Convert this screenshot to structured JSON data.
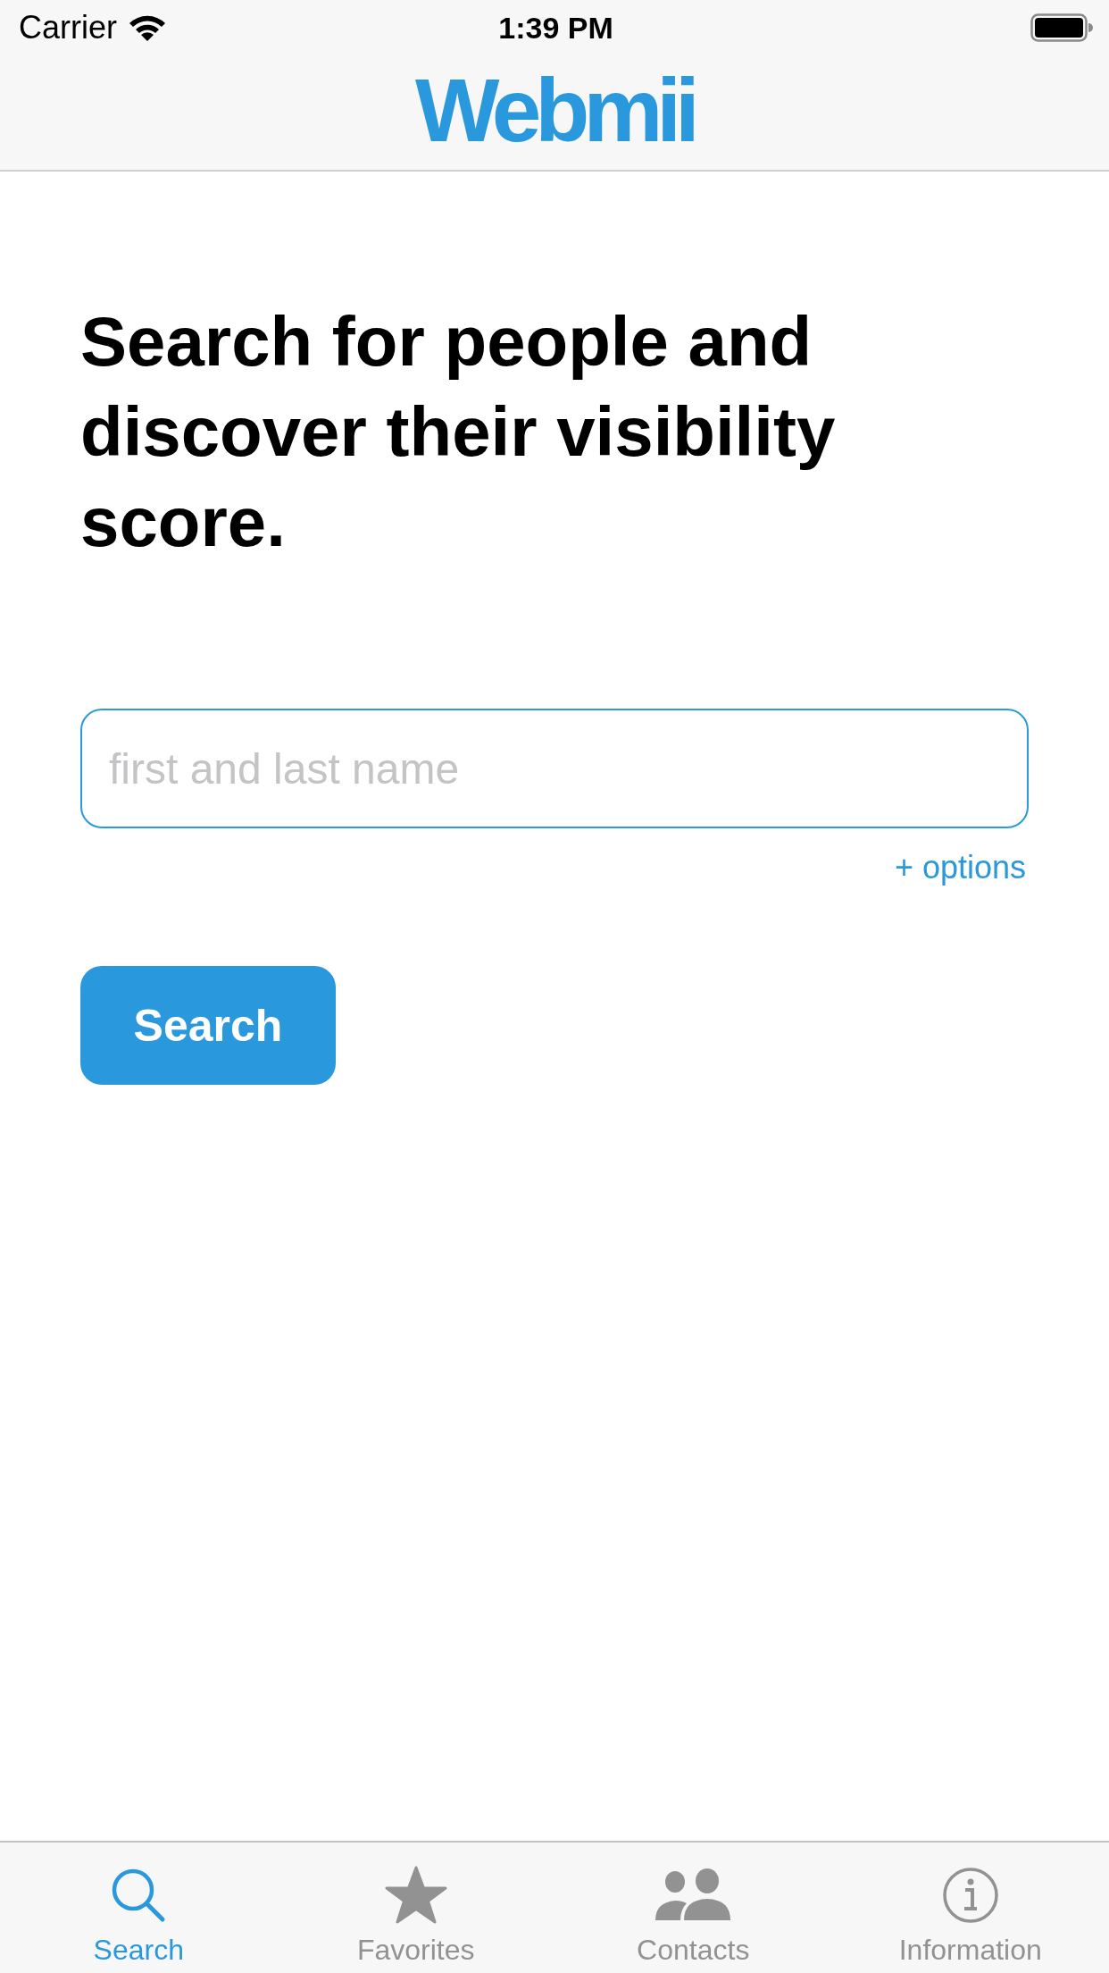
{
  "status_bar": {
    "carrier": "Carrier",
    "time": "1:39 PM"
  },
  "nav_bar": {
    "logo": "Webmii"
  },
  "headline": "Search for people and discover their visibility score.",
  "search_field": {
    "placeholder": "first and last name"
  },
  "options_link": "+ options",
  "search_button": "Search",
  "tab_bar": [
    {
      "kind": "search",
      "label": "Search",
      "selected": true
    },
    {
      "kind": "favorites",
      "label": "Favorites",
      "selected": false
    },
    {
      "kind": "contacts",
      "label": "Contacts",
      "selected": false
    },
    {
      "kind": "information",
      "label": "Information",
      "selected": false
    }
  ]
}
